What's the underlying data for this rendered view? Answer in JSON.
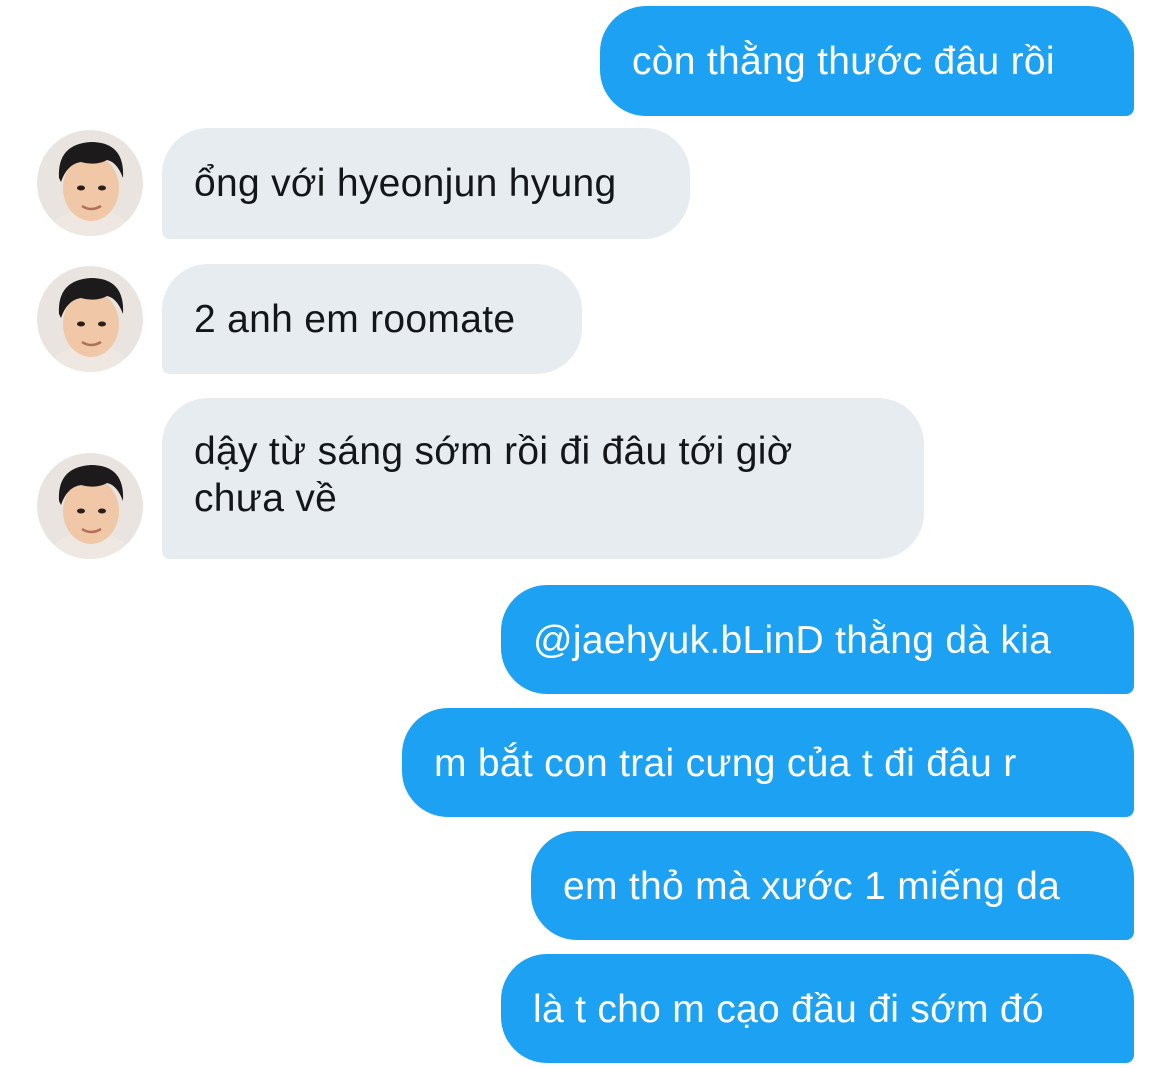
{
  "messages": [
    {
      "side": "out",
      "text": "còn thằng thước đâu rồi"
    },
    {
      "side": "in",
      "text": "ổng với hyeonjun hyung",
      "avatar": "sender-avatar-photo"
    },
    {
      "side": "in",
      "text": "2 anh em roomate",
      "avatar": "sender-avatar-photo"
    },
    {
      "side": "in",
      "text": "dậy từ sáng sớm rồi đi đâu tới giờ chưa về",
      "avatar": "sender-avatar-photo"
    },
    {
      "side": "out",
      "text": "@jaehyuk.bLinD thằng dà kia"
    },
    {
      "side": "out",
      "text": "m bắt con trai cưng của t đi đâu r"
    },
    {
      "side": "out",
      "text": "em thỏ mà xước 1 miếng da"
    },
    {
      "side": "out",
      "text": "là t cho m cạo đầu đi sớm đó"
    }
  ],
  "colors": {
    "outgoing_bubble": "#1da1f2",
    "incoming_bubble": "#e6ecf0",
    "outgoing_text": "#ffffff",
    "incoming_text": "#14171a",
    "background": "#ffffff"
  }
}
